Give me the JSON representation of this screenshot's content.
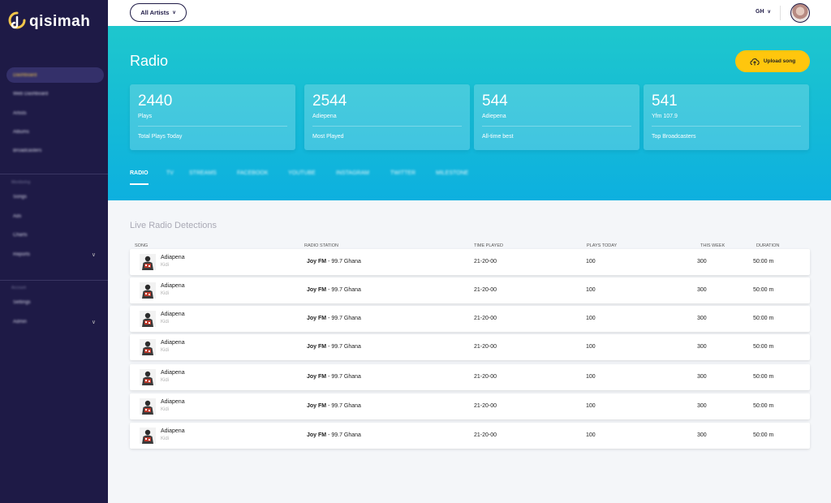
{
  "app": {
    "logo_text": "qisimah"
  },
  "sidebar": {
    "items": [
      {
        "label": "Dashboard",
        "active": true
      },
      {
        "label": "Web Dashboard"
      },
      {
        "label": "Artists"
      },
      {
        "label": "Albums"
      },
      {
        "label": "Broadcasters"
      }
    ],
    "section2_title": "Monitoring",
    "items2": [
      {
        "label": "Songs"
      },
      {
        "label": "Ads"
      },
      {
        "label": "Charts"
      },
      {
        "label": "Reports",
        "chevron": "∨"
      }
    ],
    "section3_title": "Account",
    "items3": [
      {
        "label": "Settings"
      },
      {
        "label": "Admin",
        "chevron": "∨"
      }
    ]
  },
  "topbar": {
    "artist_select": "All Artists",
    "region": "GH",
    "chevron": "∨"
  },
  "hero": {
    "title": "Radio",
    "upload_label": "Upload song",
    "cards": [
      {
        "value": "2440",
        "sub": "Plays",
        "label": "Total Plays Today"
      },
      {
        "value": "2544",
        "sub": "Adiepena",
        "label": "Most Played"
      },
      {
        "value": "544",
        "sub": "Adiepena",
        "label": "All-time best"
      },
      {
        "value": "541",
        "sub": "Yfm 107.9",
        "label": "Top Broadcasters"
      }
    ],
    "tabs": [
      "RADIO",
      "TV",
      "STREAMS",
      "FACEBOOK",
      "YOUTUBE",
      "INSTAGRAM",
      "TWITTER",
      "MILESTONE"
    ]
  },
  "detections": {
    "title": "Live Radio Detections",
    "columns": {
      "song": "SONG",
      "station": "RADIO STATION",
      "time": "TIME PLAYED",
      "plays": "PLAYS TODAY",
      "week": "THIS WEEK",
      "duration": "DURATION"
    },
    "rows": [
      {
        "song": "Adiapena",
        "artist": "Kidi",
        "station_name": "Joy FM",
        "station_freq": " - 99.7 Ghana",
        "time": "21-20-00",
        "plays": "100",
        "week": "300",
        "duration": "50:00 m"
      },
      {
        "song": "Adiapena",
        "artist": "Kidi",
        "station_name": "Joy FM",
        "station_freq": " - 99.7 Ghana",
        "time": "21-20-00",
        "plays": "100",
        "week": "300",
        "duration": "50:00 m"
      },
      {
        "song": "Adiapena",
        "artist": "Kidi",
        "station_name": "Joy FM",
        "station_freq": " - 99.7 Ghana",
        "time": "21-20-00",
        "plays": "100",
        "week": "300",
        "duration": "50:00 m"
      },
      {
        "song": "Adiapena",
        "artist": "Kidi",
        "station_name": "Joy FM",
        "station_freq": " - 99.7 Ghana",
        "time": "21-20-00",
        "plays": "100",
        "week": "300",
        "duration": "50:00 m"
      },
      {
        "song": "Adiapena",
        "artist": "Kidi",
        "station_name": "Joy FM",
        "station_freq": " - 99.7 Ghana",
        "time": "21-20-00",
        "plays": "100",
        "week": "300",
        "duration": "50:00 m"
      },
      {
        "song": "Adiapena",
        "artist": "Kidi",
        "station_name": "Joy FM",
        "station_freq": " - 99.7 Ghana",
        "time": "21-20-00",
        "plays": "100",
        "week": "300",
        "duration": "50:00 m"
      },
      {
        "song": "Adiapena",
        "artist": "Kidi",
        "station_name": "Joy FM",
        "station_freq": " - 99.7 Ghana",
        "time": "21-20-00",
        "plays": "100",
        "week": "300",
        "duration": "50:00 m"
      }
    ]
  }
}
